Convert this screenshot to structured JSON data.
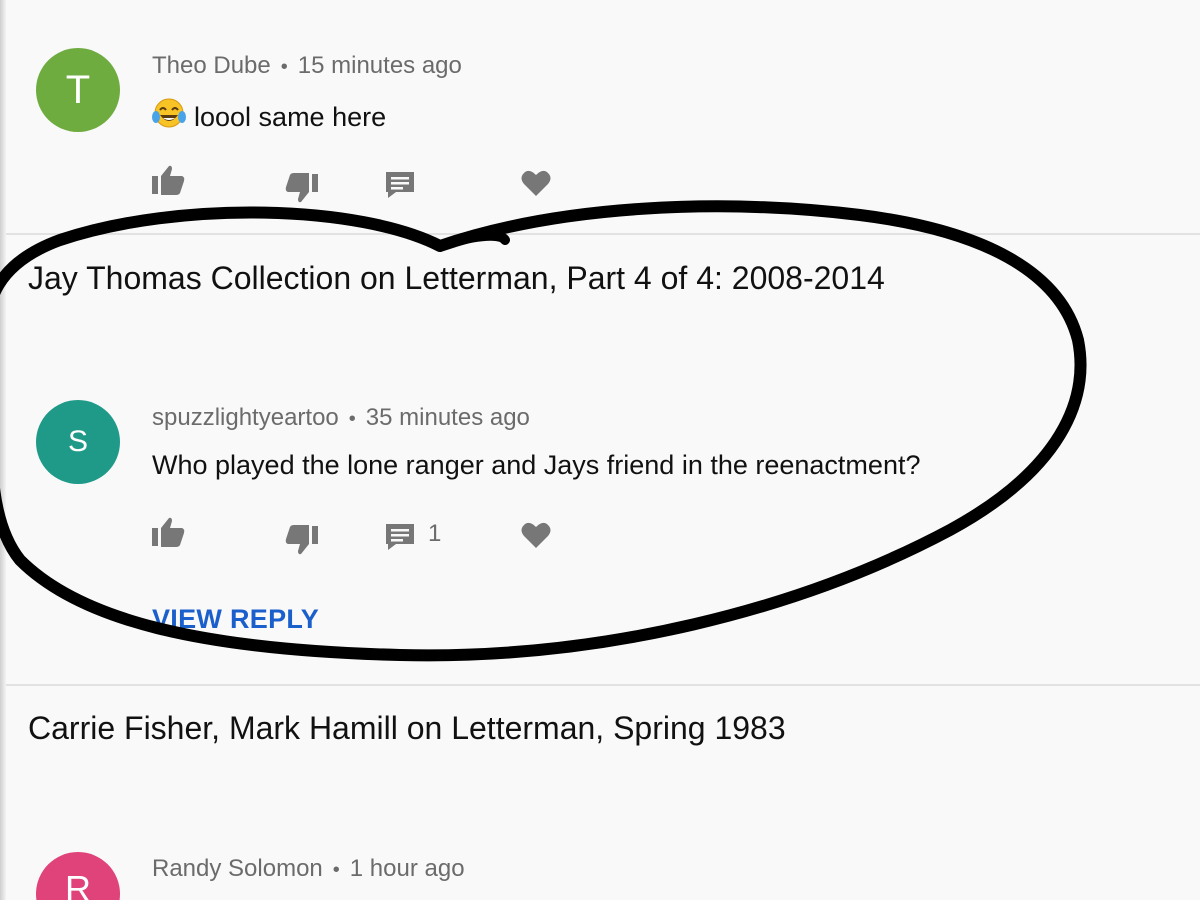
{
  "comments": [
    {
      "avatar_letter": "T",
      "avatar_color": "#6fac3f",
      "author": "Theo Dube",
      "separator": "•",
      "time": "15 minutes ago",
      "emoji_icon": "tears-of-joy-emoji-icon",
      "text": "loool same here",
      "actions": [
        "like-icon",
        "dislike-icon",
        "reply-icon",
        "heart-icon"
      ]
    },
    {
      "video_title": "Jay Thomas Collection on Letterman, Part 4 of 4: 2008-2014",
      "avatar_letter": "S",
      "avatar_color": "#1f9a88",
      "author": "spuzzlightyeartoo",
      "separator": "•",
      "time": "35 minutes ago",
      "text": "Who played the lone ranger and Jays friend in the reenactment?",
      "reply_count": "1",
      "view_reply_label": "VIEW REPLY",
      "actions": [
        "like-icon",
        "dislike-icon",
        "reply-icon",
        "heart-icon"
      ]
    },
    {
      "video_title": "Carrie Fisher, Mark Hamill on Letterman, Spring 1983",
      "avatar_letter": "R",
      "avatar_color": "#e0427a",
      "author": "Randy Solomon",
      "separator": "•",
      "time": "1 hour ago"
    }
  ],
  "colors": {
    "link_blue": "#1a5fcb",
    "icon_gray": "#777777",
    "meta_gray": "#6b6b6b",
    "annotation_ink": "#000000"
  },
  "annotation": "hand-drawn-circle-around-second-comment"
}
